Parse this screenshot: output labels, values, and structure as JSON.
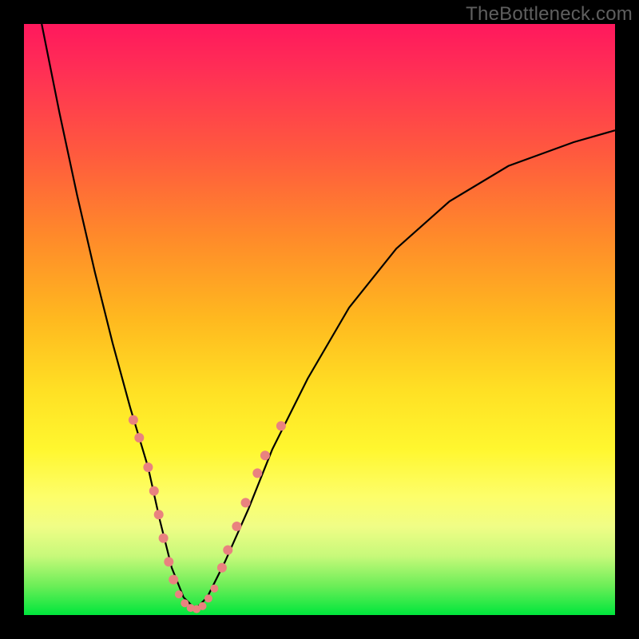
{
  "watermark": "TheBottleneck.com",
  "chart_data": {
    "type": "line",
    "title": "",
    "xlabel": "",
    "ylabel": "",
    "xlim": [
      0,
      100
    ],
    "ylim": [
      0,
      100
    ],
    "background_gradient": {
      "top": "#ff185d",
      "mid_upper": "#ff8a2a",
      "mid": "#ffe024",
      "lower": "#6dee58",
      "bottom": "#00e63c"
    },
    "series": [
      {
        "name": "bottleneck-curve",
        "color": "#000000",
        "x": [
          3,
          6,
          9,
          12,
          15,
          18,
          21,
          23,
          25,
          27,
          29,
          31,
          34,
          38,
          42,
          48,
          55,
          63,
          72,
          82,
          93,
          100
        ],
        "y": [
          100,
          85,
          71,
          58,
          46,
          35,
          25,
          16,
          8,
          3,
          1,
          3,
          9,
          18,
          28,
          40,
          52,
          62,
          70,
          76,
          80,
          82
        ]
      }
    ],
    "marker_clusters": [
      {
        "name": "left-cluster",
        "color": "#e9827f",
        "radius": 6,
        "points": [
          {
            "x": 18.5,
            "y": 33
          },
          {
            "x": 19.5,
            "y": 30
          },
          {
            "x": 21.0,
            "y": 25
          },
          {
            "x": 22.0,
            "y": 21
          },
          {
            "x": 22.8,
            "y": 17
          },
          {
            "x": 23.6,
            "y": 13
          },
          {
            "x": 24.5,
            "y": 9
          },
          {
            "x": 25.3,
            "y": 6
          }
        ]
      },
      {
        "name": "bottom-cluster",
        "color": "#e9827f",
        "radius": 5,
        "points": [
          {
            "x": 26.2,
            "y": 3.5
          },
          {
            "x": 27.2,
            "y": 2.0
          },
          {
            "x": 28.2,
            "y": 1.2
          },
          {
            "x": 29.2,
            "y": 1.0
          },
          {
            "x": 30.2,
            "y": 1.5
          },
          {
            "x": 31.2,
            "y": 2.8
          },
          {
            "x": 32.2,
            "y": 4.5
          }
        ]
      },
      {
        "name": "right-cluster",
        "color": "#e9827f",
        "radius": 6,
        "points": [
          {
            "x": 33.5,
            "y": 8
          },
          {
            "x": 34.5,
            "y": 11
          },
          {
            "x": 36.0,
            "y": 15
          },
          {
            "x": 37.5,
            "y": 19
          },
          {
            "x": 39.5,
            "y": 24
          },
          {
            "x": 40.8,
            "y": 27
          },
          {
            "x": 43.5,
            "y": 32
          }
        ]
      }
    ]
  }
}
